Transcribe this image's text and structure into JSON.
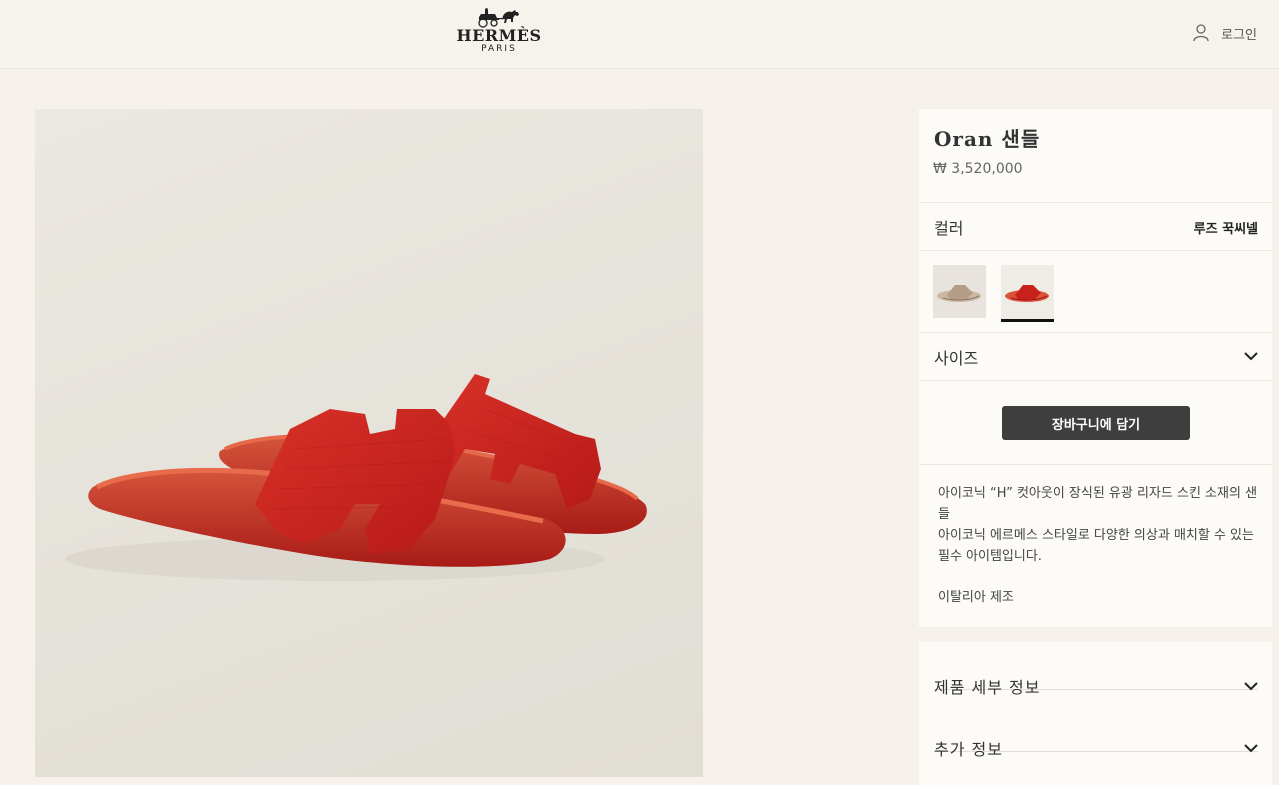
{
  "header": {
    "brand_name": "HERMÈS",
    "brand_sub": "PARIS",
    "login_label": "로그인",
    "login_icon": "user-icon"
  },
  "product": {
    "title": "Oran 샌들",
    "price": "₩ 3,520,000",
    "color_label": "컬러",
    "color_value": "루즈 꾹씨넬",
    "swatches": [
      "beige sandal",
      "red sandal"
    ],
    "selected_swatch_index": 1,
    "size_label": "사이즈",
    "add_to_cart_label": "장바구니에 담기",
    "description_line1": "아이코닉 “H” 컷아웃이 장식된 유광 리자드 스킨 소재의 샌들",
    "description_line2": "아이코닉 에르메스 스타일로 다양한 의상과 매치할 수 있는 필수 아이템입니다.",
    "made_in": "이탈리아 제조"
  },
  "details": {
    "items": [
      {
        "label": "제품 세부 정보"
      },
      {
        "label": "추가 정보"
      }
    ]
  },
  "colors": {
    "sandal_red": "#c9221d",
    "background": "#f6f1eb",
    "panel": "#fdfbf8",
    "button": "#3e3e3e"
  }
}
